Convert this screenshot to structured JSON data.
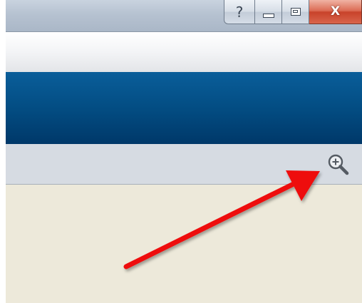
{
  "window": {
    "caption_buttons": {
      "help_label": "?",
      "minimize_icon": "minimize-icon",
      "maximize_icon": "maximize-icon",
      "close_label": "X"
    }
  },
  "zoombar": {
    "zoom_icon": "zoom-in-icon"
  },
  "annotation": {
    "arrow_color": "#ee1111",
    "points_to": "zoom-in-icon"
  },
  "colors": {
    "banner": "#034d83",
    "zoombar": "#d6dbe2",
    "content": "#ede9da",
    "close_button": "#c8422a"
  }
}
